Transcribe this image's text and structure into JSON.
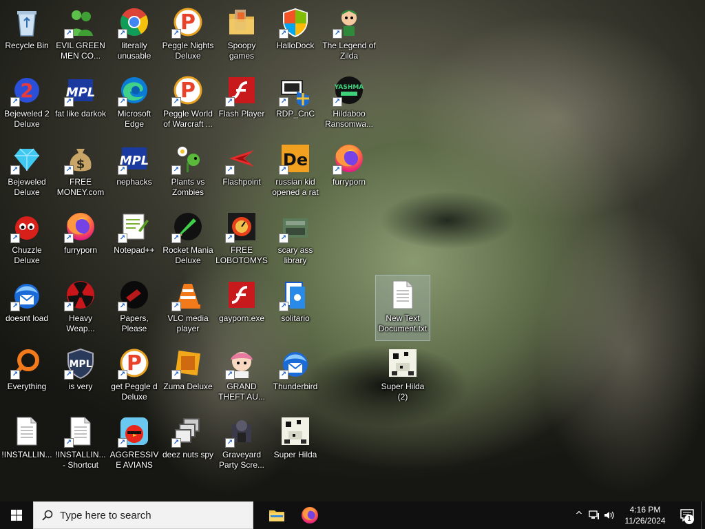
{
  "desktop": {
    "icons": [
      {
        "label": "Recycle Bin",
        "icon": "recycle-bin-icon",
        "col": 0,
        "row": 0,
        "shortcut": false
      },
      {
        "label": "EVIL GREEN MEN CO...",
        "icon": "green-men-icon",
        "col": 1,
        "row": 0,
        "shortcut": true
      },
      {
        "label": "literally unusable",
        "icon": "chrome-icon",
        "col": 2,
        "row": 0,
        "shortcut": true
      },
      {
        "label": "Peggle Nights Deluxe",
        "icon": "peggle-icon",
        "col": 3,
        "row": 0,
        "shortcut": true
      },
      {
        "label": "Spoopy games",
        "icon": "folder-icon",
        "col": 4,
        "row": 0,
        "shortcut": false
      },
      {
        "label": "HalloDock",
        "icon": "windows-shield-icon",
        "col": 5,
        "row": 0,
        "shortcut": true
      },
      {
        "label": "The Legend of Zilda",
        "icon": "zelda-icon",
        "col": 6,
        "row": 0,
        "shortcut": true
      },
      {
        "label": "Bejeweled 2 Deluxe",
        "icon": "bejeweled-2-icon",
        "col": 0,
        "row": 1,
        "shortcut": true
      },
      {
        "label": "fat like darkok",
        "icon": "mpl-icon",
        "col": 1,
        "row": 1,
        "shortcut": true
      },
      {
        "label": "Microsoft Edge",
        "icon": "edge-icon",
        "col": 2,
        "row": 1,
        "shortcut": true
      },
      {
        "label": "Peggle World of Warcraft ...",
        "icon": "peggle-icon",
        "col": 3,
        "row": 1,
        "shortcut": true
      },
      {
        "label": "Flash Player",
        "icon": "flash-icon",
        "col": 4,
        "row": 1,
        "shortcut": true
      },
      {
        "label": "RDP_CnC",
        "icon": "rdp-icon",
        "col": 5,
        "row": 1,
        "shortcut": true
      },
      {
        "label": "Hildaboo Ransomwa...",
        "icon": "yashma-icon",
        "col": 6,
        "row": 1,
        "shortcut": true
      },
      {
        "label": "Bejeweled Deluxe",
        "icon": "gem-icon",
        "col": 0,
        "row": 2,
        "shortcut": true
      },
      {
        "label": "FREE MONEY.com",
        "icon": "money-bag-icon",
        "col": 1,
        "row": 2,
        "shortcut": true
      },
      {
        "label": "nephacks",
        "icon": "mpl-icon",
        "col": 2,
        "row": 2,
        "shortcut": true
      },
      {
        "label": "Plants vs Zombies",
        "icon": "plant-icon",
        "col": 3,
        "row": 2,
        "shortcut": true
      },
      {
        "label": "Flashpoint",
        "icon": "flashpoint-icon",
        "col": 4,
        "row": 2,
        "shortcut": true
      },
      {
        "label": "russian kid opened a rat",
        "icon": "de-icon",
        "col": 5,
        "row": 2,
        "shortcut": true
      },
      {
        "label": "furryporn",
        "icon": "firefox-icon",
        "col": 6,
        "row": 2,
        "shortcut": true
      },
      {
        "label": "Chuzzle Deluxe",
        "icon": "chuzzle-icon",
        "col": 0,
        "row": 3,
        "shortcut": true
      },
      {
        "label": "furryporn",
        "icon": "firefox-icon",
        "col": 1,
        "row": 3,
        "shortcut": true
      },
      {
        "label": "Notepad++",
        "icon": "notepadpp-icon",
        "col": 2,
        "row": 3,
        "shortcut": true
      },
      {
        "label": "Rocket Mania Deluxe",
        "icon": "rocket-icon",
        "col": 3,
        "row": 3,
        "shortcut": true
      },
      {
        "label": "FREE LOBOTOMYS",
        "icon": "lobotomy-icon",
        "col": 4,
        "row": 3,
        "shortcut": true
      },
      {
        "label": "scary ass library",
        "icon": "library-icon",
        "col": 5,
        "row": 3,
        "shortcut": true
      },
      {
        "label": "doesnt load",
        "icon": "thunderbird-icon",
        "col": 0,
        "row": 4,
        "shortcut": true
      },
      {
        "label": "Heavy Weap...",
        "icon": "radiation-icon",
        "col": 1,
        "row": 4,
        "shortcut": true
      },
      {
        "label": "Papers, Please",
        "icon": "papers-please-icon",
        "col": 2,
        "row": 4,
        "shortcut": true
      },
      {
        "label": "VLC media player",
        "icon": "vlc-icon",
        "col": 3,
        "row": 4,
        "shortcut": true
      },
      {
        "label": "gayporn.exe",
        "icon": "flash-icon",
        "col": 4,
        "row": 4,
        "shortcut": false
      },
      {
        "label": "solitario",
        "icon": "solitaire-icon",
        "col": 5,
        "row": 4,
        "shortcut": true
      },
      {
        "label": "Everything",
        "icon": "magnifier-icon",
        "col": 0,
        "row": 5,
        "shortcut": true
      },
      {
        "label": "is very",
        "icon": "mpl-shield-icon",
        "col": 1,
        "row": 5,
        "shortcut": true
      },
      {
        "label": "get Peggle d Deluxe",
        "icon": "peggle-icon",
        "col": 2,
        "row": 5,
        "shortcut": true
      },
      {
        "label": "Zuma Deluxe",
        "icon": "zuma-icon",
        "col": 3,
        "row": 5,
        "shortcut": true
      },
      {
        "label": "GRAND THEFT AU...",
        "icon": "anime-girl-icon",
        "col": 4,
        "row": 5,
        "shortcut": true
      },
      {
        "label": "Thunderbird",
        "icon": "thunderbird-icon",
        "col": 5,
        "row": 5,
        "shortcut": true
      },
      {
        "label": "!INSTALLIN...",
        "icon": "text-file-icon",
        "col": 0,
        "row": 6,
        "shortcut": false
      },
      {
        "label": "!INSTALLIN... - Shortcut",
        "icon": "text-file-icon",
        "col": 1,
        "row": 6,
        "shortcut": true
      },
      {
        "label": "AGGRESSIVE AVIANS",
        "icon": "angry-bird-icon",
        "col": 2,
        "row": 6,
        "shortcut": true
      },
      {
        "label": "deez nuts spy",
        "icon": "windows-stack-icon",
        "col": 3,
        "row": 6,
        "shortcut": true
      },
      {
        "label": "Graveyard Party Scre...",
        "icon": "graveyard-icon",
        "col": 4,
        "row": 6,
        "shortcut": true
      },
      {
        "label": "Super Hilda",
        "icon": "pixel-hilda-icon",
        "col": 5,
        "row": 6,
        "shortcut": false
      },
      {
        "label": "New Text Document.txt",
        "icon": "text-file-icon",
        "col": 7,
        "row": 4,
        "shortcut": false,
        "selected": true
      },
      {
        "label": "Super Hilda (2)",
        "icon": "pixel-hilda-icon",
        "col": 7,
        "row": 5,
        "shortcut": false
      }
    ]
  },
  "taskbar": {
    "start_icon": "windows-logo-icon",
    "search_placeholder": "Type here to search",
    "pinned": [
      {
        "name": "file-explorer",
        "icon": "folder-icon"
      },
      {
        "name": "firefox",
        "icon": "firefox-icon"
      }
    ],
    "tray": {
      "chevron": "^",
      "time": "4:16 PM",
      "date": "11/26/2024",
      "notification_count": "1"
    }
  },
  "colors": {
    "taskbar_bg": "#101010",
    "search_bg": "#f2f2f2",
    "shortcut_arrow": "#1a5fc8"
  }
}
